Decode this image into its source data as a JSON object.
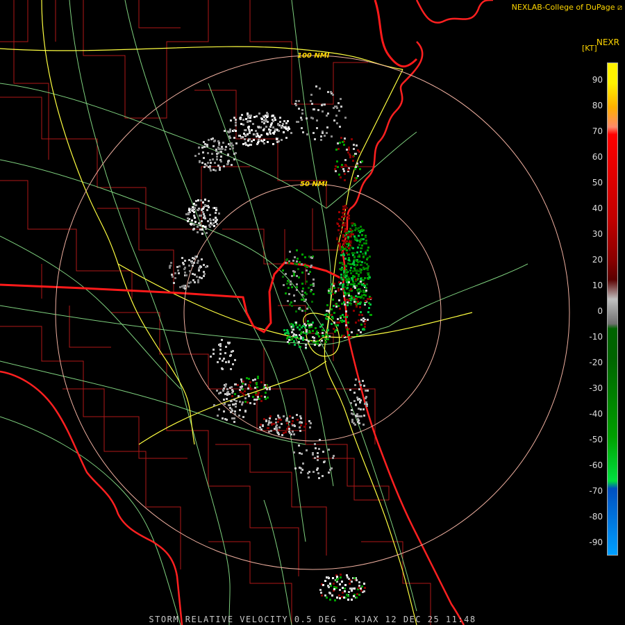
{
  "header": {
    "credit": "NEXLAB-College of DuPage",
    "product": "NEXR",
    "unit": "[KT]"
  },
  "range_rings": [
    {
      "label": "100 NMI"
    },
    {
      "label": "50 NMI"
    }
  ],
  "legend": {
    "labels": [
      "90",
      "80",
      "70",
      "60",
      "50",
      "40",
      "30",
      "20",
      "10",
      "0",
      "-10",
      "-20",
      "-30",
      "-40",
      "-50",
      "-60",
      "-70",
      "-80",
      "-90"
    ],
    "gradient": [
      "#fff200",
      "#ffb000",
      "#ff8a6a",
      "#ff0000",
      "#c00000",
      "#8a0000",
      "#5a0000",
      "#c0c0c0",
      "#707070",
      "#006400",
      "#00a000",
      "#00e040",
      "#0050c0",
      "#00a0ff"
    ]
  },
  "footer": "STORM RELATIVE VELOCITY 0.5 DEG - KJAX 12 DEC 25 11:48",
  "colors": {
    "coast": "#ff2020",
    "county": "#b01818",
    "state": "#ff1a1a",
    "highway": "#ffff40",
    "road": "#7fd17f",
    "ring": "#f0b0a0"
  }
}
